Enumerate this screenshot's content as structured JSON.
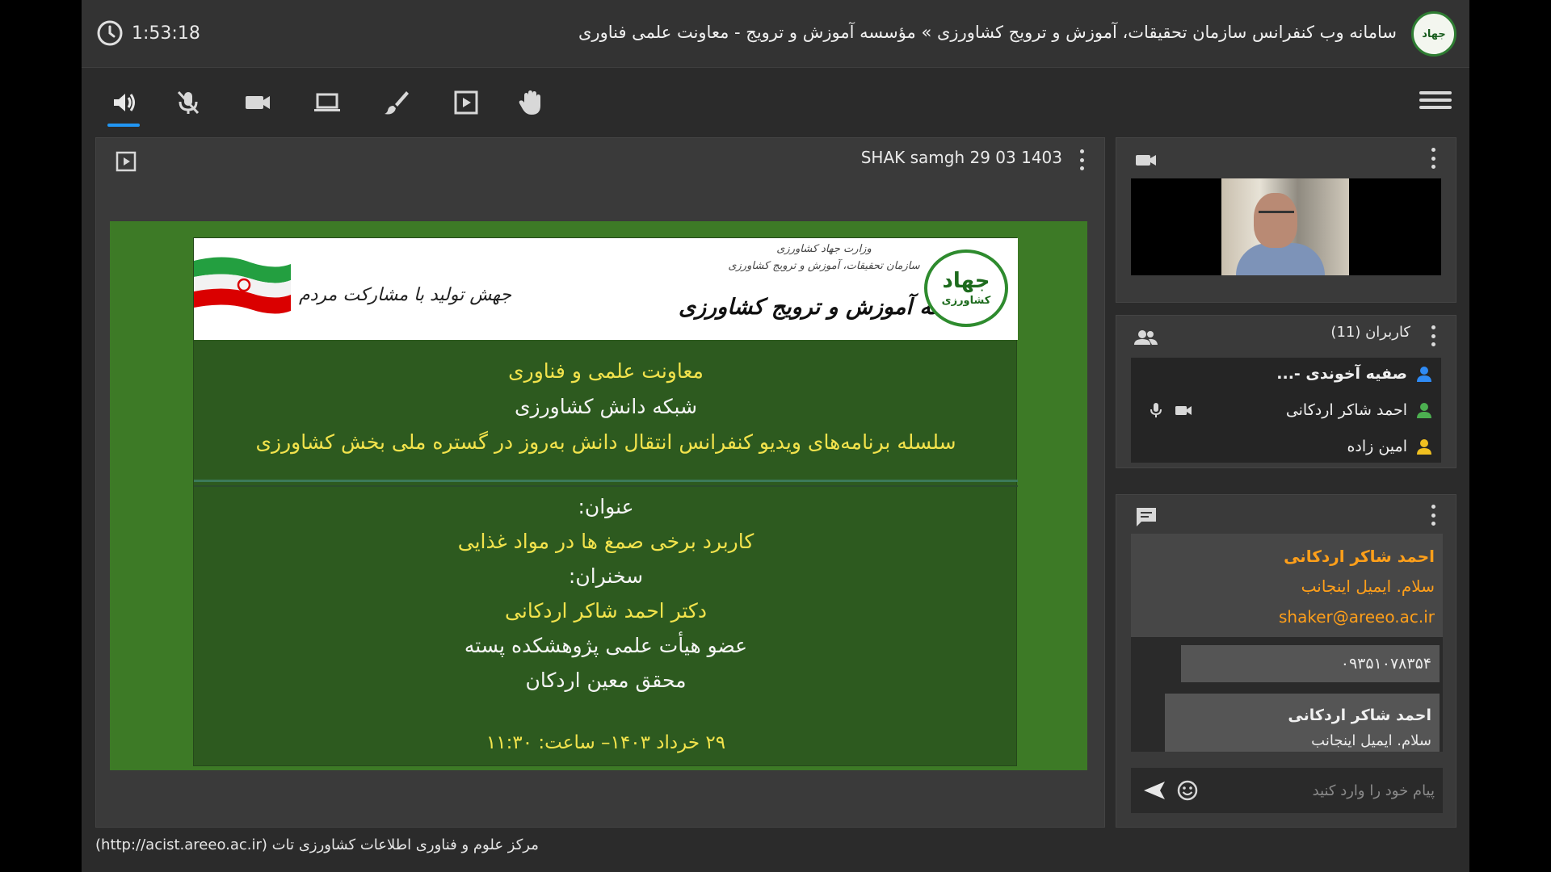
{
  "header": {
    "time": "1:53:18",
    "title": "سامانه وب کنفرانس سازمان تحقیقات، آموزش و ترویج کشاورزی » مؤسسه آموزش و ترویج - معاونت علمی فناوری",
    "logo_text": "جهاد"
  },
  "toolbar": {
    "items": [
      "speaker-icon",
      "mic-off-icon",
      "camera-icon",
      "screen-share-icon",
      "brush-icon",
      "presentation-icon",
      "raise-hand-icon",
      "menu-icon"
    ]
  },
  "presentation": {
    "name": "SHAK samgh 29 03 1403"
  },
  "slide": {
    "banner": {
      "slogan": "جهش تولید با مشارکت مردم",
      "ministry_line1": "وزارت جهاد کشاورزی",
      "ministry_line2": "سازمان تحقیقات، آموزش و ترویج کشاورزی",
      "institute": "موسسه آموزش و ترویج کشاورزی",
      "logo_line1": "جهاد",
      "logo_line2": "کشاورزی"
    },
    "line1": "معاونت علمی و فناوری",
    "line2": "شبکه دانش کشاورزی",
    "line3": "سلسله برنامه‌های ویدیو کنفرانس انتقال دانش به‌روز در گستره ملی بخش کشاورزی",
    "title_label": "عنوان:",
    "title": "کاربرد برخی صمغ ها در مواد غذایی",
    "speaker_label": "سخنران:",
    "speaker": "دکتر احمد شاکر اردکانی",
    "speaker_role": "عضو هیأت علمی پژوهشکده پسته",
    "speaker_affiliation": "محقق معین اردکان",
    "date": "۲۹ خرداد ۱۴۰۳– ساعت: ۱۱:۳۰"
  },
  "footer": "مرکز علوم و فناوری اطلاعات کشاورزی تات (http://acist.areeo.ac.ir)",
  "users": {
    "title": "کاربران (11)",
    "list": [
      {
        "name": "صفیه آخوندی -...",
        "color": "#2f8bf5"
      },
      {
        "name": "احمد شاکر اردکانی",
        "color": "#4caf50"
      },
      {
        "name": "امین زاده",
        "color": "#f0c020"
      }
    ]
  },
  "chat": {
    "messages": [
      {
        "sender": "احمد شاکر اردکانی",
        "lines": [
          "سلام. ایمیل اینجانب",
          "shaker@areeo.ac.ir"
        ]
      },
      {
        "sender": "",
        "lines": [
          "۰۹۳۵۱۰۷۸۳۵۴"
        ]
      },
      {
        "sender": "احمد شاکر اردکانی",
        "lines": [
          "سلام. ایمیل اینجانب"
        ]
      }
    ],
    "placeholder": "پیام خود را وارد کنید"
  },
  "colors": {
    "accent": "#2196f3",
    "chat_highlight": "#ff9f1a",
    "slide_yellow": "#f2e34c",
    "slide_green": "#2d5a1f"
  }
}
